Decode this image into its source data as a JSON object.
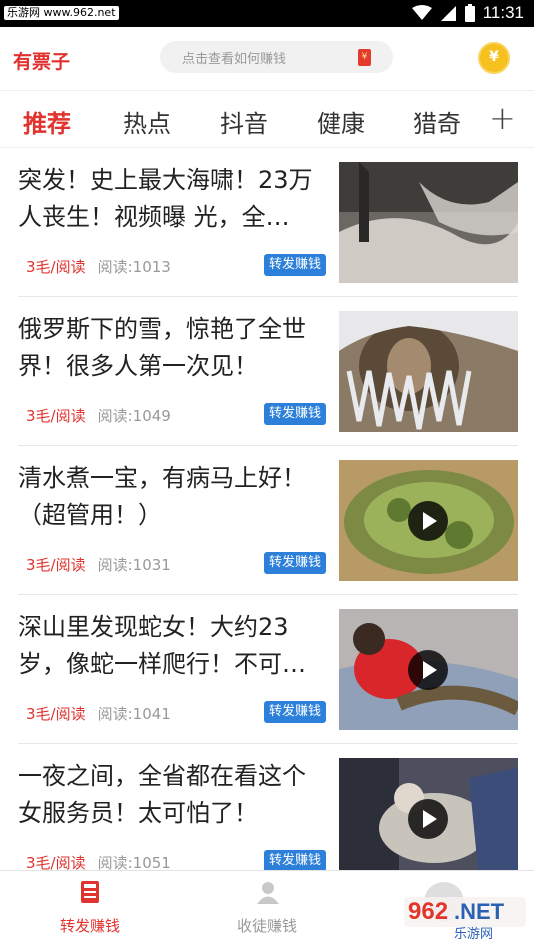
{
  "status_bar": {
    "watermark": "乐游网 www.962.net",
    "time": "11:31"
  },
  "header": {
    "app_title": "有票子",
    "search_placeholder": "点击查看如何赚钱"
  },
  "tabs": [
    {
      "label": "推荐",
      "active": true
    },
    {
      "label": "热点",
      "active": false
    },
    {
      "label": "抖音",
      "active": false
    },
    {
      "label": "健康",
      "active": false
    },
    {
      "label": "猎奇",
      "active": false
    }
  ],
  "tab_add_label": "+",
  "articles": [
    {
      "title": "突发！史上最大海啸！23万人丧生！视频曝 光，全…",
      "price": "3毛/阅读",
      "reads": "阅读:1013",
      "badge": "转发赚钱",
      "has_video": false
    },
    {
      "title": "俄罗斯下的雪，惊艳了全世界！很多人第一次见！",
      "price": "3毛/阅读",
      "reads": "阅读:1049",
      "badge": "转发赚钱",
      "has_video": false
    },
    {
      "title": "清水煮一宝，有病马上好！（超管用！）",
      "price": "3毛/阅读",
      "reads": "阅读:1031",
      "badge": "转发赚钱",
      "has_video": true
    },
    {
      "title": "深山里发现蛇女！大约23岁，像蛇一样爬行！不可…",
      "price": "3毛/阅读",
      "reads": "阅读:1041",
      "badge": "转发赚钱",
      "has_video": true
    },
    {
      "title": "一夜之间，全省都在看这个女服务员！太可怕了！",
      "price": "3毛/阅读",
      "reads": "阅读:1051",
      "badge": "转发赚钱",
      "has_video": true
    }
  ],
  "bottom_nav": [
    {
      "label": "转发赚钱",
      "icon": "newspaper-icon",
      "active": true
    },
    {
      "label": "收徒赚钱",
      "icon": "user-icon",
      "active": false
    }
  ],
  "brand_watermark": "962.NET 乐游网",
  "colors": {
    "accent": "#e0332f",
    "badge": "#2d80d9",
    "coin": "#f6c01e",
    "muted": "#999999"
  }
}
